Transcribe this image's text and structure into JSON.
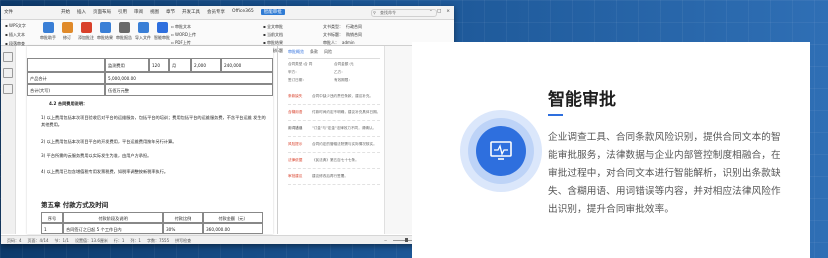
{
  "feature": {
    "title": "智能审批",
    "description": "企业调查工具、合同条款风险识别，提供合同文本的智能审批服务，法律数据与企业内部管控制度相融合，在审批过程中，对合同文本进行智能解析，识别出条款缺失、含糊用语、用词错误等内容，并对相应法律风险作出识别，提升合同审批效率。",
    "icon": "monitor-pulse-icon",
    "accent_color": "#2e6fde"
  },
  "window": {
    "file_menu": "文件",
    "tabs": [
      "开始",
      "插入",
      "页面布局",
      "引用",
      "审阅",
      "视图",
      "章节",
      "开发工具",
      "会员专享",
      "Office365",
      "智能审批"
    ],
    "active_tab": "智能审批",
    "search_placeholder": "查找命令",
    "ribbon": {
      "left_items": [
        "WPS文字",
        "插入文本",
        "段落审查"
      ],
      "big_buttons": [
        "审批助手",
        "修订",
        "添加批注",
        "审批结果",
        "审批报告",
        "导入文件",
        "智能审批"
      ],
      "middle_items": [
        "审批文本",
        "WORD上传",
        "PDF上传"
      ],
      "right_labels": [
        "全文审批",
        "当前文档",
        "审批结果",
        "二级标题"
      ],
      "right_fields": [
        "文书类型：",
        "文书标题：",
        "审批人："
      ],
      "right_values": [
        "行政合同",
        "购销合同",
        "admin"
      ]
    },
    "document": {
      "table_rows": [
        [
          "",
          "监测费用",
          "120",
          "月",
          "2,000",
          "240,000"
        ],
        [
          "产品合计",
          "5,000,000.00"
        ],
        [
          "合计(大写)",
          "伍佰万元整"
        ]
      ],
      "section_heading": "4.2 合同费用说明：",
      "clauses": [
        "1)  以上费用包括本次项目验收后对平台的运维服务，包括平台的培训；费用包括平台的运维服务费，不含平台运维 发生的其他费用。",
        "2)  以上费用包括本次项目平台的开发费用，平台运维费用按年另行计算。",
        "3)  平台所需的云服务费用以实际发生为准，由用户方承担。",
        "4)  以上费用已包含增值税专用发票税费，如税率调整按新税率执行。"
      ],
      "chapter_title": "第五章  付款方式及时间",
      "pay_table_headers": [
        "序号",
        "付款阶段及说明",
        "付款比例",
        "付款金额（元）"
      ],
      "pay_table_rows": [
        [
          "1",
          "合同签订之日起 5 个工作日内",
          "30%",
          "360,000.00"
        ]
      ]
    },
    "review": {
      "tab_labels": [
        "审批概览",
        "条款",
        "风险"
      ],
      "head_fields": [
        [
          "合同类型：",
          "合 同",
          "合同金额：",
          "元"
        ],
        [
          "甲方：",
          "",
          "乙方：",
          ""
        ],
        [
          "签订日期：",
          "",
          "有效期限：",
          ""
        ]
      ],
      "items": [
        {
          "tag": "条款缺失",
          "text": "合同中缺少违约责任条款，建议补充。",
          "color": "#d9412b"
        },
        {
          "tag": "含糊用语",
          "text": "付款时间约定不明确，建议补充具体日期。",
          "color": "#d9412b"
        },
        {
          "tag": "用词错误",
          "text": "\"订金\"与\"定金\"法律效力不同，请确认。",
          "color": "#333333"
        },
        {
          "tag": "风险提示",
          "text": "合同约定的管辖法院需与实际情况核实。",
          "color": "#d9412b"
        },
        {
          "tag": "法律依据",
          "text": "《民法典》第五百七十七条。",
          "color": "#d9412b"
        },
        {
          "tag": "审批建议",
          "text": "建议修改后再行签署。",
          "color": "#d9412b"
        }
      ]
    },
    "status": {
      "page": "页码：4",
      "pages": "页面：4/14",
      "section": "节：1/1",
      "position": "设置值：13.6厘米",
      "row": "行：1",
      "col": "列：1",
      "words": "字数：7555",
      "spell": "拼写检查",
      "zoom": "100%"
    }
  }
}
